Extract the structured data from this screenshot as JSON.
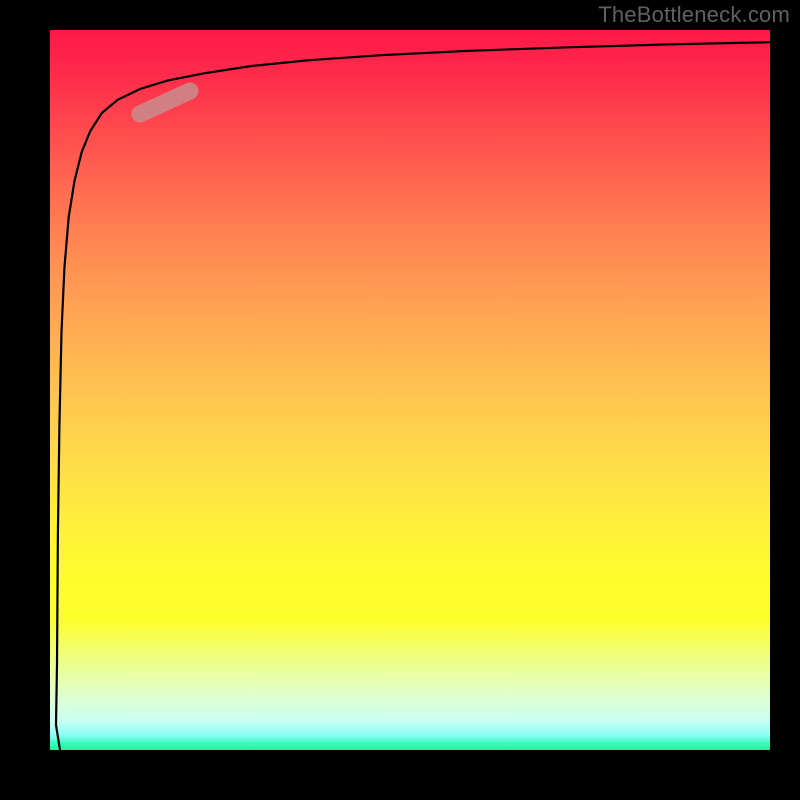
{
  "watermark": "TheBottleneck.com",
  "colors": {
    "background": "#000000",
    "curve": "#000000",
    "marker": "#ce8588",
    "watermark_text": "#616161"
  },
  "chart_data": {
    "type": "line",
    "title": "",
    "xlabel": "",
    "ylabel": "",
    "xlim": [
      0,
      100
    ],
    "ylim": [
      0,
      100
    ],
    "grid": false,
    "legend": false,
    "background_gradient": {
      "direction": "top-to-bottom",
      "stops": [
        {
          "pos": 0,
          "color": "#fe1848"
        },
        {
          "pos": 50,
          "color": "#ffb048"
        },
        {
          "pos": 80,
          "color": "#fdfd2b"
        },
        {
          "pos": 100,
          "color": "#1bf59c"
        }
      ]
    },
    "series": [
      {
        "name": "curve",
        "note": "steep logarithmic-like rise from bottom-left to top-right",
        "x": [
          0.8,
          1,
          1.1,
          1.3,
          1.6,
          2,
          2.6,
          3.4,
          4.4,
          5.6,
          7.2,
          9.4,
          12.5,
          16.4,
          21.5,
          28,
          36,
          46,
          58,
          72,
          86,
          100
        ],
        "y": [
          0,
          12,
          30,
          45,
          58,
          67,
          74,
          79,
          83,
          86,
          88.5,
          90.3,
          91.8,
          93,
          94,
          95,
          95.8,
          96.5,
          97.1,
          97.6,
          98,
          98.3
        ]
      }
    ],
    "marker": {
      "description": "highlighted segment on curve",
      "x_range": [
        12.5,
        19.5
      ],
      "y_range": [
        88.3,
        91.5
      ]
    }
  }
}
